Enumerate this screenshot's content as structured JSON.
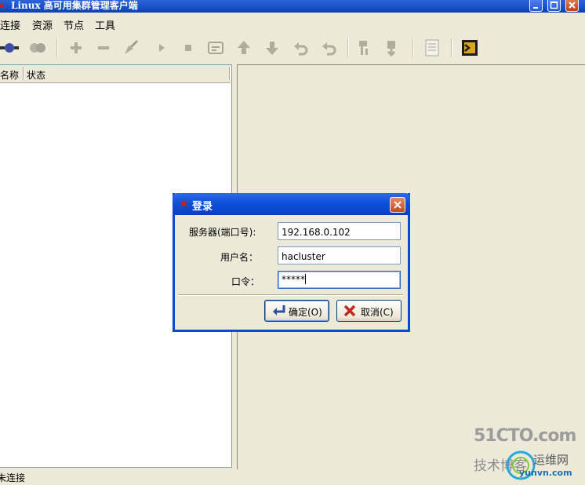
{
  "window": {
    "title": "Linux 高可用集群管理客户端"
  },
  "menu": {
    "items": [
      "连接",
      "资源",
      "节点",
      "工具"
    ]
  },
  "toolbar": {
    "icons": [
      "connect-icon",
      "disconnect-icon",
      "add-icon",
      "remove-icon",
      "cleanup-icon",
      "start-icon",
      "stop-icon",
      "properties-icon",
      "move-up-icon",
      "move-down-icon",
      "undo-icon",
      "redo-icon",
      "standby-node-icon",
      "active-node-icon",
      "log-icon",
      "exit-icon"
    ]
  },
  "list": {
    "columns": [
      "名称",
      "状态"
    ]
  },
  "status": {
    "text": "未连接"
  },
  "login_dialog": {
    "title": "登录",
    "server_label": "服务器(端口号):",
    "server_value": "192.168.0.102",
    "user_label": "用户名：",
    "user_value": "hacluster",
    "password_label": "口令：",
    "password_value": "*****",
    "ok_label": "确定(O)",
    "cancel_label": "取消(C)"
  },
  "watermark": {
    "line1": "51CTO.com",
    "line2": "技术博客",
    "line3": "运维网",
    "line4": "yunvn.com"
  },
  "colors": {
    "accent": "#0a48d8",
    "window_bg": "#ece9d8"
  }
}
